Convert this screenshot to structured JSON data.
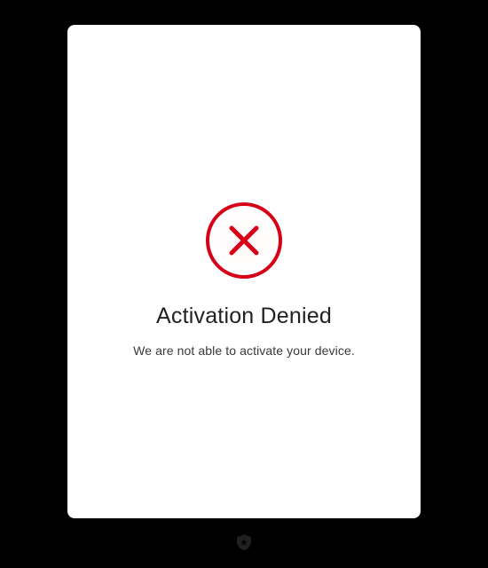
{
  "error": {
    "title": "Activation Denied",
    "message": "We are not able to activate your device.",
    "icon_color": "#d60017"
  }
}
